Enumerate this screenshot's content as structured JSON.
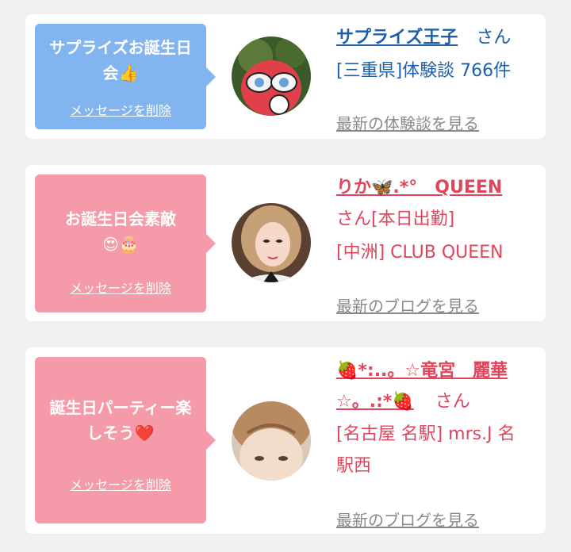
{
  "cards": [
    {
      "message": "サプライズお誕生日会👍",
      "delete_label": "メッセージを削除",
      "name": "サプライズ王子",
      "honorific": "さん",
      "line1": "[三重県]体験談 766件",
      "line2": "",
      "latest_link": "最新の体験談を見る",
      "theme": "blue"
    },
    {
      "message": "お誕生日会素敵😍🎂",
      "delete_label": "メッセージを削除",
      "name": "りか🦋.*°　QUEEN",
      "honorific": "さん[本日出勤]",
      "line1": "[中洲] CLUB QUEEN",
      "latest_link": "最新のブログを見る",
      "theme": "pink"
    },
    {
      "message": "誕生日パーティー楽しそう❤️",
      "delete_label": "メッセージを削除",
      "name_line1": "🍓*:..。☆竜宮　麗華",
      "name_line2": "☆。.:*🍓",
      "honorific": "さん",
      "line1": "[名古屋 名駅] mrs.J 名",
      "line2": "駅西",
      "latest_link": "最新のブログを見る",
      "theme": "pink"
    }
  ],
  "colors": {
    "blue_bubble": "#82b4f0",
    "pink_bubble": "#f59aa8",
    "blue_text": "#1d5fa8",
    "pink_text": "#e0455c",
    "background": "#f0f0f0"
  }
}
